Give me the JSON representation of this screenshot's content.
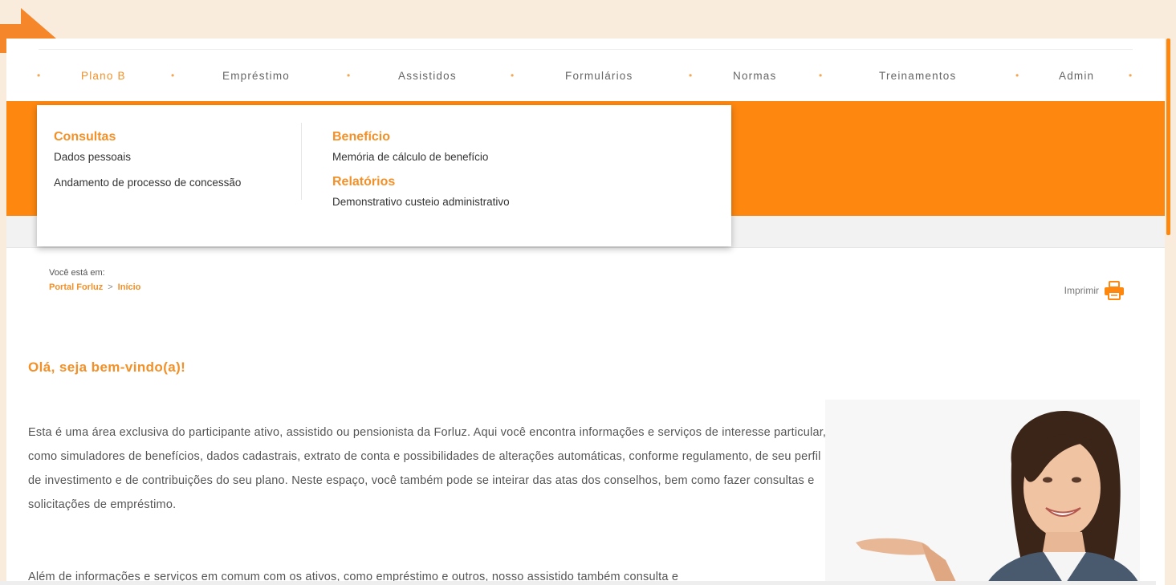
{
  "nav": {
    "items": [
      "Plano B",
      "Empréstimo",
      "Assistidos",
      "Formulários",
      "Normas",
      "Treinamentos",
      "Admin"
    ],
    "active": "Plano B",
    "dot": "•"
  },
  "dropdown": {
    "consultas": {
      "heading": "Consultas",
      "links": [
        "Dados pessoais",
        "Andamento de processo de concessão"
      ]
    },
    "beneficio": {
      "heading": "Benefício",
      "links": [
        "Memória de cálculo de benefício"
      ]
    },
    "relatorios": {
      "heading": "Relatórios",
      "links": [
        "Demonstrativo custeio administrativo"
      ]
    }
  },
  "breadcrumb": {
    "label": "Você está em:",
    "items": [
      "Portal Forluz",
      "Início"
    ],
    "separator": ">"
  },
  "print": {
    "label": "Imprimir",
    "icon": "printer-icon"
  },
  "content": {
    "title": "Olá, seja bem-vindo(a)!",
    "paragraph1": "Esta é uma área exclusiva do participante ativo, assistido ou pensionista da Forluz. Aqui você encontra informações e serviços de interesse particular, como simuladores de benefícios, dados cadastrais, extrato de conta e possibilidades de alterações automáticas, conforme regulamento, de seu perfil de investimento e de contribuições do seu plano. Neste espaço, você também pode se inteirar das atas dos conselhos, bem como fazer consultas e solicitações de empréstimo.",
    "paragraph2": "Além de informações e serviços em comum com os ativos, como empréstimo e outros, nosso assistido também consulta e"
  },
  "colors": {
    "accent": "#f39027",
    "band": "#fd870f",
    "background": "#faecdc"
  }
}
